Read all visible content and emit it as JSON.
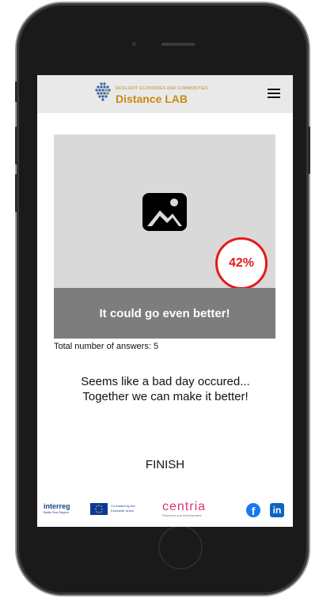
{
  "header": {
    "logo_tagline": "RESILIENT ECONOMIES AND COMMUNITIES",
    "logo_title": "Distance LAB",
    "menu_icon": "hamburger-menu-icon"
  },
  "result": {
    "image_icon": "image-placeholder-icon",
    "percentage": "42%",
    "banner_text": "It could go even better!",
    "total_answers": "Total number of answers: 5",
    "message": "Seems like a bad day occured... Together we can make it better!",
    "finish_label": "FINISH"
  },
  "footer": {
    "interreg_title": "interreg",
    "interreg_subtitle": "Baltic Sea Region",
    "eu_text": "Co-funded by the European Union",
    "centria_title": "centria",
    "centria_subtitle": "Research and Development",
    "facebook_icon": "facebook-icon",
    "linkedin_icon": "linkedin-icon",
    "facebook_glyph": "f",
    "linkedin_glyph": "in"
  },
  "colors": {
    "accent_gold": "#c98a12",
    "percentage_red": "#e31b1b",
    "banner_gray": "#7d7d7d",
    "header_bg": "#e9e9e9"
  }
}
